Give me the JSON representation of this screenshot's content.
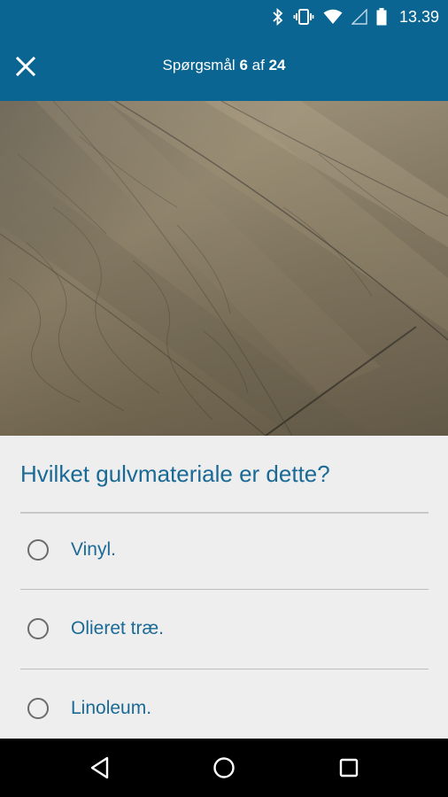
{
  "status_bar": {
    "time": "13.39",
    "icons": [
      "bluetooth-icon",
      "vibrate-icon",
      "wifi-icon",
      "signal-icon",
      "battery-icon"
    ]
  },
  "app_bar": {
    "title_prefix": "Spørgsmål",
    "current": "6",
    "of_word": "af",
    "total": "24",
    "close_icon": "close-icon"
  },
  "image": {
    "description_icon": "wooden-floor-photo"
  },
  "question": {
    "text": "Hvilket gulvmateriale er dette?",
    "options": [
      {
        "label": "Vinyl."
      },
      {
        "label": "Olieret træ."
      },
      {
        "label": "Linoleum."
      }
    ]
  },
  "nav_bar": {
    "icons": [
      "back-icon",
      "home-icon",
      "recents-icon"
    ]
  },
  "colors": {
    "primary": "#0a6592",
    "accent_text": "#1a6a95",
    "background": "#eeeeee"
  }
}
